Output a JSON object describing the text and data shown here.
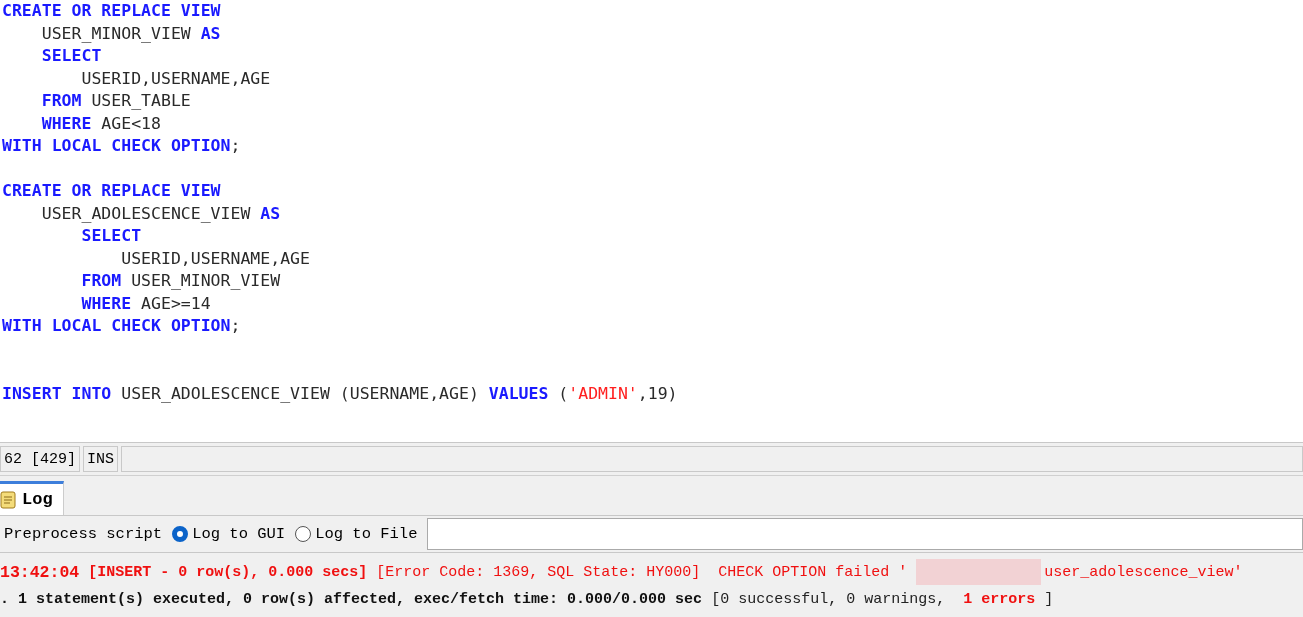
{
  "editor": {
    "blocks": [
      [
        [
          {
            "kind": "keyword",
            "text": "CREATE OR REPLACE VIEW"
          }
        ],
        [
          {
            "kind": "plain",
            "text": "    USER_MINOR_VIEW "
          },
          {
            "kind": "keyword",
            "text": "AS"
          }
        ],
        [
          {
            "kind": "keyword",
            "text": "    SELECT"
          }
        ],
        [
          {
            "kind": "plain",
            "text": "        USERID,USERNAME,AGE"
          }
        ],
        [
          {
            "kind": "keyword",
            "text": "    FROM"
          },
          {
            "kind": "plain",
            "text": " USER_TABLE"
          }
        ],
        [
          {
            "kind": "keyword",
            "text": "    WHERE"
          },
          {
            "kind": "plain",
            "text": " AGE<18"
          }
        ],
        [
          {
            "kind": "keyword",
            "text": "WITH LOCAL CHECK OPTION"
          },
          {
            "kind": "plain",
            "text": ";"
          }
        ]
      ],
      [
        [
          {
            "kind": "keyword",
            "text": "CREATE OR REPLACE VIEW"
          }
        ],
        [
          {
            "kind": "plain",
            "text": "    USER_ADOLESCENCE_VIEW "
          },
          {
            "kind": "keyword",
            "text": "AS"
          }
        ],
        [
          {
            "kind": "keyword",
            "text": "        SELECT"
          }
        ],
        [
          {
            "kind": "plain",
            "text": "            USERID,USERNAME,AGE"
          }
        ],
        [
          {
            "kind": "keyword",
            "text": "        FROM"
          },
          {
            "kind": "plain",
            "text": " USER_MINOR_VIEW"
          }
        ],
        [
          {
            "kind": "keyword",
            "text": "        WHERE"
          },
          {
            "kind": "plain",
            "text": " AGE>=14"
          }
        ],
        [
          {
            "kind": "keyword",
            "text": "WITH LOCAL CHECK OPTION"
          },
          {
            "kind": "plain",
            "text": ";"
          }
        ]
      ]
    ],
    "statement": [
      {
        "kind": "keyword",
        "text": "INSERT INTO"
      },
      {
        "kind": "plain",
        "text": " USER_ADOLESCENCE_VIEW (USERNAME,AGE) "
      },
      {
        "kind": "keyword",
        "text": "VALUES"
      },
      {
        "kind": "plain",
        "text": " ("
      },
      {
        "kind": "string",
        "text": "'ADMIN'"
      },
      {
        "kind": "plain",
        "text": ",19)"
      }
    ]
  },
  "status_bar": {
    "position": "62 [429]",
    "mode": "INS"
  },
  "tabs": [
    {
      "label": "Log",
      "selected": true
    }
  ],
  "options": {
    "preprocess": "Preprocess script",
    "radios": [
      {
        "label": "Log to GUI",
        "selected": true
      },
      {
        "label": "Log to File",
        "selected": false
      }
    ]
  },
  "log": [
    [
      {
        "kind": "time",
        "text": "13:42:04"
      },
      {
        "kind": "error-bold",
        "text": "[INSERT - 0 row(s), 0.000 secs]"
      },
      {
        "kind": "error",
        "text": "[Error Code: 1369, SQL State: HY000]  CHECK OPTION failed '"
      },
      {
        "kind": "redacted"
      },
      {
        "kind": "error",
        "text": "user_adolescence_view'"
      }
    ],
    [
      {
        "kind": "bold",
        "text": ". 1 statement(s) executed, 0 row(s) affected, exec/fetch time: 0.000/0.000 sec"
      },
      {
        "kind": "plain",
        "text": "[0 successful, 0 warnings, "
      },
      {
        "kind": "error-bold",
        "text": "1 errors"
      },
      {
        "kind": "plain",
        "text": "]"
      }
    ]
  ]
}
